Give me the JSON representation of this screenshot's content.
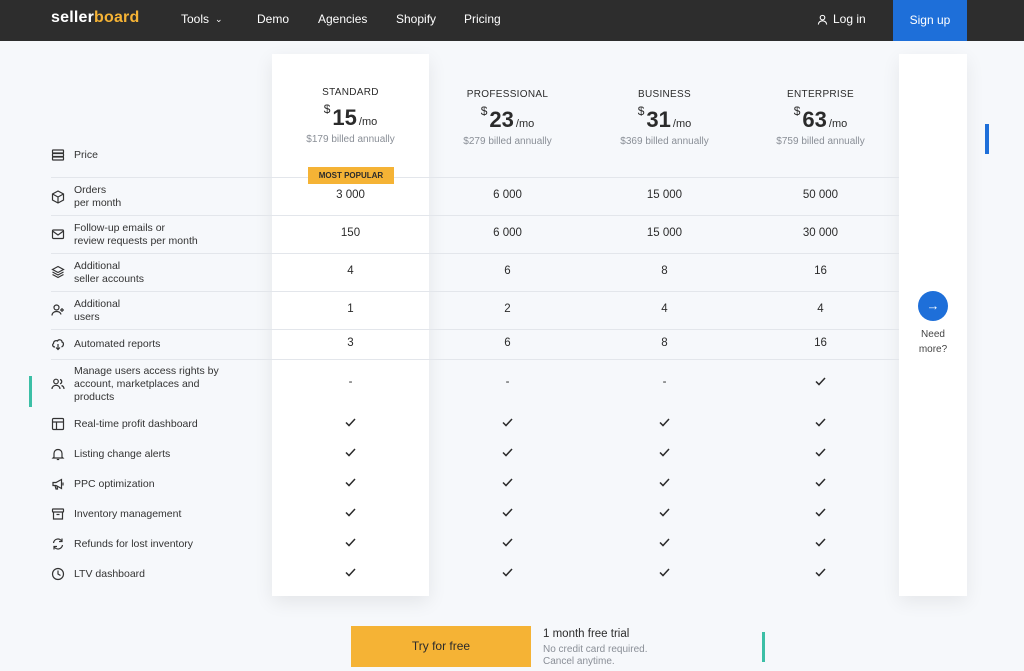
{
  "nav": {
    "logo_part1": "seller",
    "logo_part2": "board",
    "items": [
      {
        "label": "Tools",
        "has_dropdown": true
      },
      {
        "label": "Demo"
      },
      {
        "label": "Agencies"
      },
      {
        "label": "Shopify"
      },
      {
        "label": "Pricing"
      }
    ],
    "login_label": "Log in",
    "signup_label": "Sign up"
  },
  "plans": [
    {
      "name": "STANDARD",
      "currency": "$",
      "price": "15",
      "period": "/mo",
      "billed": "$179 billed annually",
      "badge": "MOST POPULAR"
    },
    {
      "name": "PROFESSIONAL",
      "currency": "$",
      "price": "23",
      "period": "/mo",
      "billed": "$279 billed annually"
    },
    {
      "name": "BUSINESS",
      "currency": "$",
      "price": "31",
      "period": "/mo",
      "billed": "$369 billed annually"
    },
    {
      "name": "ENTERPRISE",
      "currency": "$",
      "price": "63",
      "period": "/mo",
      "billed": "$759 billed annually"
    }
  ],
  "price_label": "Price",
  "features": [
    {
      "label": "Orders\nper month",
      "icon": "box-icon",
      "values": [
        "3 000",
        "6 000",
        "15 000",
        "50 000"
      ]
    },
    {
      "label": "Follow-up emails or\nreview requests per month",
      "icon": "mail-icon",
      "values": [
        "150",
        "6 000",
        "15 000",
        "30 000"
      ]
    },
    {
      "label": "Additional\nseller accounts",
      "icon": "layers-icon",
      "values": [
        "4",
        "6",
        "8",
        "16"
      ]
    },
    {
      "label": "Additional\nusers",
      "icon": "user-plus-icon",
      "values": [
        "1",
        "2",
        "4",
        "4"
      ]
    },
    {
      "label": "Automated reports",
      "icon": "cloud-download-icon",
      "values": [
        "3",
        "6",
        "8",
        "16"
      ]
    },
    {
      "label": "Manage users access rights by\naccount, marketplaces and\nproducts",
      "icon": "users-icon",
      "values": [
        "-",
        "-",
        "-",
        "check"
      ]
    },
    {
      "label": "Real-time profit dashboard",
      "icon": "dashboard-icon",
      "values": [
        "check",
        "check",
        "check",
        "check"
      ]
    },
    {
      "label": "Listing change alerts",
      "icon": "bell-icon",
      "values": [
        "check",
        "check",
        "check",
        "check"
      ]
    },
    {
      "label": "PPC optimization",
      "icon": "megaphone-icon",
      "values": [
        "check",
        "check",
        "check",
        "check"
      ]
    },
    {
      "label": "Inventory management",
      "icon": "archive-icon",
      "values": [
        "check",
        "check",
        "check",
        "check"
      ]
    },
    {
      "label": "Refunds for lost inventory",
      "icon": "refresh-icon",
      "values": [
        "check",
        "check",
        "check",
        "check"
      ]
    },
    {
      "label": "LTV dashboard",
      "icon": "clock-icon",
      "values": [
        "check",
        "check",
        "check",
        "check"
      ]
    }
  ],
  "need_more": {
    "arrow": "→",
    "label": "Need\nmore?"
  },
  "cta": {
    "button_label": "Try for free",
    "title": "1 month free trial",
    "sub1": "No credit card required.",
    "sub2": "Cancel anytime."
  },
  "colors": {
    "accent_blue": "#1e6fd9",
    "accent_yellow": "#f5b335",
    "teal": "#3cbfa6",
    "nav_bg": "#2d2d2d"
  }
}
